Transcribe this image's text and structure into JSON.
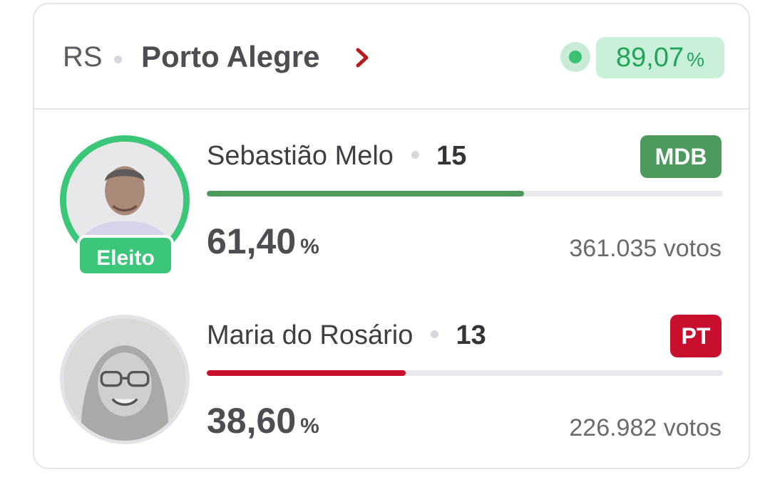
{
  "header": {
    "state": "RS",
    "city": "Porto Alegre",
    "apurado_value": "89,07",
    "apurado_unit": "%"
  },
  "colors": {
    "live_green": "#3cbf72",
    "mdb": "#4e9a5d",
    "pt": "#c8102e",
    "elected": "#3cc679"
  },
  "candidates": [
    {
      "name": "Sebastião Melo",
      "number": "15",
      "party": "MDB",
      "share_value": "61,40",
      "share_unit": "%",
      "share_fraction": 0.614,
      "votes": "361.035 votos",
      "elected_label": "Eleito"
    },
    {
      "name": "Maria do Rosário",
      "number": "13",
      "party": "PT",
      "share_value": "38,60",
      "share_unit": "%",
      "share_fraction": 0.386,
      "votes": "226.982 votos"
    }
  ]
}
